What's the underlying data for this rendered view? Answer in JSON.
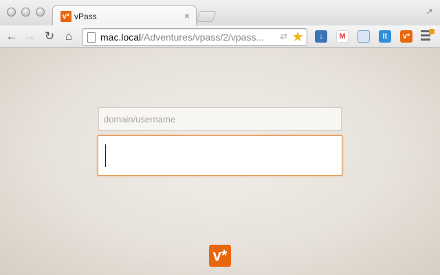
{
  "window": {
    "controls": [
      "close",
      "minimize",
      "zoom"
    ],
    "fullscreen_icon": "↗"
  },
  "tab": {
    "favicon_text": "v*",
    "title": "vPass",
    "close_glyph": "×"
  },
  "toolbar": {
    "back_glyph": "←",
    "forward_glyph": "→",
    "reload_glyph": "↻",
    "home_glyph": "⌂",
    "url_host": "mac.local",
    "url_path": "/Adventures/vpass/2/vpass...",
    "star_glyph": "★",
    "sync_glyph": "⇄"
  },
  "extensions": [
    {
      "name": "download",
      "glyph": "↓"
    },
    {
      "name": "gmail",
      "glyph": "M"
    },
    {
      "name": "window",
      "glyph": ""
    },
    {
      "name": "instapaper",
      "glyph": "it"
    },
    {
      "name": "vpass",
      "glyph": "v*"
    }
  ],
  "form": {
    "username_placeholder": "domain/username",
    "username_value": "",
    "password_value": ""
  },
  "logo_text": "v*",
  "colors": {
    "accent": "#e8660c",
    "focus_border": "#e18a35",
    "background": "#e9e5de"
  }
}
